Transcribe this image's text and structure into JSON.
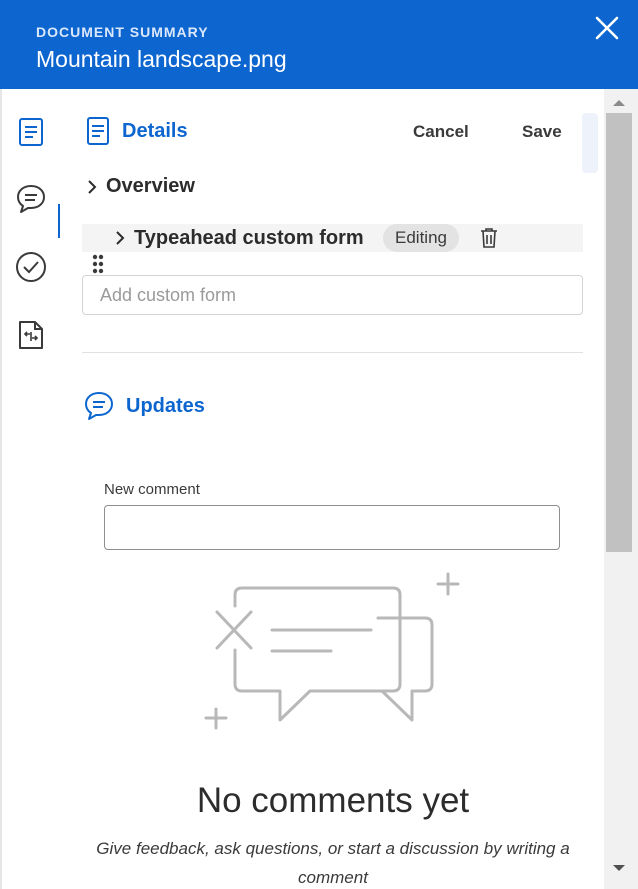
{
  "header": {
    "eyebrow": "DOCUMENT SUMMARY",
    "title": "Mountain landscape.png",
    "close_icon": "close-icon"
  },
  "sidebar": {
    "tabs": [
      {
        "icon": "document-icon",
        "active": true
      },
      {
        "icon": "comment-icon",
        "active": false
      },
      {
        "icon": "checkmark-circle-icon",
        "active": false
      },
      {
        "icon": "file-share-icon",
        "active": false
      }
    ]
  },
  "details": {
    "title": "Details",
    "cancel_label": "Cancel",
    "save_label": "Save",
    "overview_label": "Overview",
    "custom_form": {
      "label": "Typeahead custom form",
      "badge": "Editing"
    },
    "add_form_placeholder": "Add custom form"
  },
  "updates": {
    "title": "Updates",
    "new_comment_label": "New comment",
    "empty_title": "No comments yet",
    "empty_description": "Give feedback, ask questions, or start a discussion by writing a comment"
  },
  "colors": {
    "accent": "#0d66d0",
    "header_bg": "#0d66d0"
  }
}
